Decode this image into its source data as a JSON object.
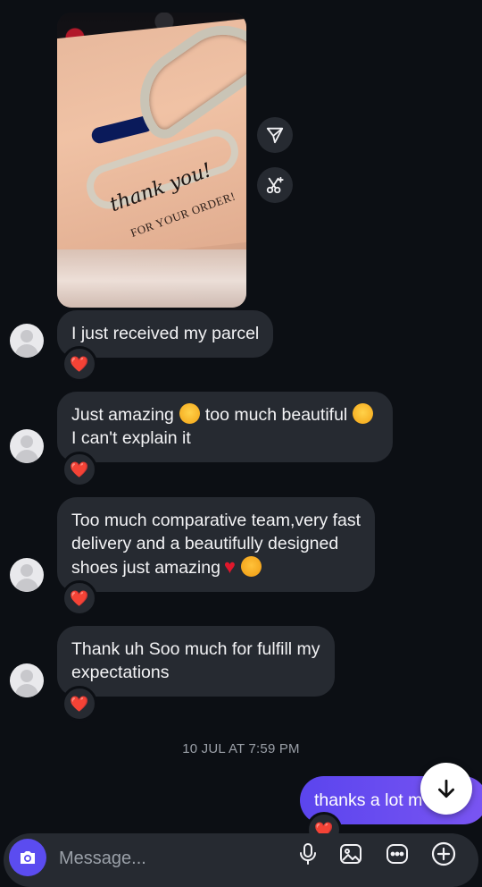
{
  "photo_message": {
    "caption_line1": "thank you!",
    "caption_line2": "FOR YOUR ORDER!"
  },
  "messages": [
    {
      "text_line1": "I just received my parcel",
      "reaction": "❤️"
    },
    {
      "text_line1_a": "Just amazing",
      "text_line1_b": "too much beautiful",
      "text_line2": "I can't explain it",
      "reaction": "❤️"
    },
    {
      "text_line1": "Too much comparative team,very fast",
      "text_line2": "delivery and a beautifully designed",
      "text_line3": "shoes just amazing",
      "reaction": "❤️"
    },
    {
      "text_line1": "Thank uh Soo much for fulfill my",
      "text_line2": "expectations",
      "reaction": "❤️"
    }
  ],
  "timestamp": "10 JUL AT 7:59 PM",
  "sent_message": {
    "text": "thanks a lot m",
    "reaction": "❤️"
  },
  "composer": {
    "placeholder": "Message..."
  },
  "icons": {
    "share": "paper-plane-icon",
    "remix": "scissors-sparkle-icon",
    "scroll_down": "arrow-down-icon",
    "camera": "camera-icon",
    "mic": "microphone-icon",
    "gallery": "image-icon",
    "sticker": "sticker-icon",
    "add": "plus-circle-icon"
  },
  "colors": {
    "background": "#0c0f14",
    "bubble_received": "#262a31",
    "bubble_sent": "#6a4ef0",
    "heart": "#e0182c",
    "timestamp": "#9ba0a8"
  }
}
